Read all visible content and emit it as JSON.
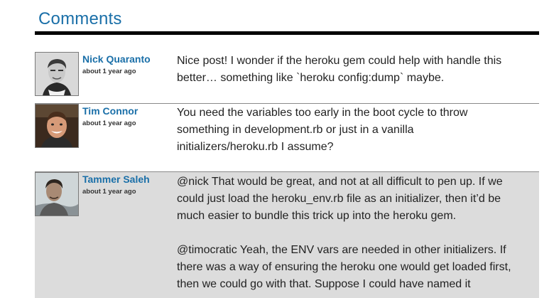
{
  "section": {
    "title": "Comments"
  },
  "comments": [
    {
      "author": "Nick Quaranto",
      "date": "about 1 year ago",
      "paragraphs": [
        "Nice post! I wonder if the heroku gem could help with handle this better… something like `heroku config:dump` maybe."
      ]
    },
    {
      "author": "Tim Connor",
      "date": "about 1 year ago",
      "paragraphs": [
        "You need the variables too early in the boot cycle to throw something in development.rb or just in a vanilla initializers/heroku.rb I assume?"
      ]
    },
    {
      "author": "Tammer Saleh",
      "date": "about 1 year ago",
      "paragraphs": [
        "@nick That would be great, and not at all difficult to pen up. If we could just load the heroku_env.rb file as an initializer, then it’d be much easier to bundle this trick up into the heroku gem.",
        "@timocratic Yeah, the ENV vars are needed in other initializers. If there was a way of ensuring the heroku one would get loaded first, then we could go with that. Suppose I could have named it"
      ]
    }
  ],
  "colors": {
    "title": "#1a6fa8",
    "author_link": "#1a6fa8",
    "rule": "#000000",
    "highlight_bg": "#dcdcdc"
  }
}
